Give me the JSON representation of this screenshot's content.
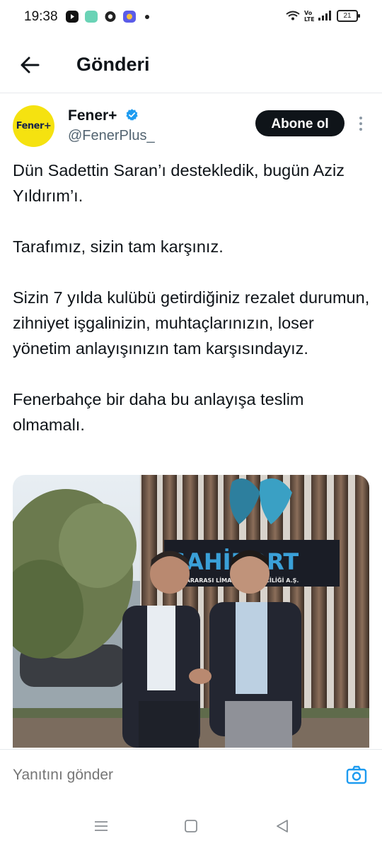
{
  "status_bar": {
    "time": "19:38",
    "battery": "21",
    "icons": [
      "youtube-icon",
      "app-icon",
      "chrome-icon",
      "app-icon",
      "dot-icon",
      "wifi-icon",
      "volte-icon",
      "signal-icon",
      "battery-icon"
    ]
  },
  "header": {
    "title": "Gönderi",
    "back_icon": "arrow-left-icon"
  },
  "tweet": {
    "avatar_text": "Fener+",
    "display_name": "Fener+",
    "handle": "@FenerPlus_",
    "follow_label": "Abone ol",
    "verified_color": "#1d9bf0",
    "text": "Dün Sadettin Saran’ı destekledik, bugün Aziz Yıldırım’ı.\n\nTarafımız, sizin tam karşınız.\n\nSizin 7 yılda kulübü getirdiğiniz rezalet durumun, zihniyet işgalinizin, muhtaçlarınızın, loser yönetim anlayışınızın tam karşısındayız.\n\nFenerbahçe bir daha bu anlayışa teslim olmamalı.",
    "image": {
      "sign_text": "SAHİPORT",
      "sign_subtext": "ULUSLARARASI LİMAN İŞLETMECİLİĞİ A.Ş."
    }
  },
  "reply": {
    "placeholder": "Yanıtını gönder",
    "camera_icon": "camera-icon"
  },
  "nav": {
    "buttons": [
      "menu-icon",
      "home-square-icon",
      "back-triangle-icon"
    ]
  },
  "colors": {
    "accent": "#1d9bf0",
    "follow_bg": "#0f1419",
    "avatar_bg": "#f5e210"
  }
}
